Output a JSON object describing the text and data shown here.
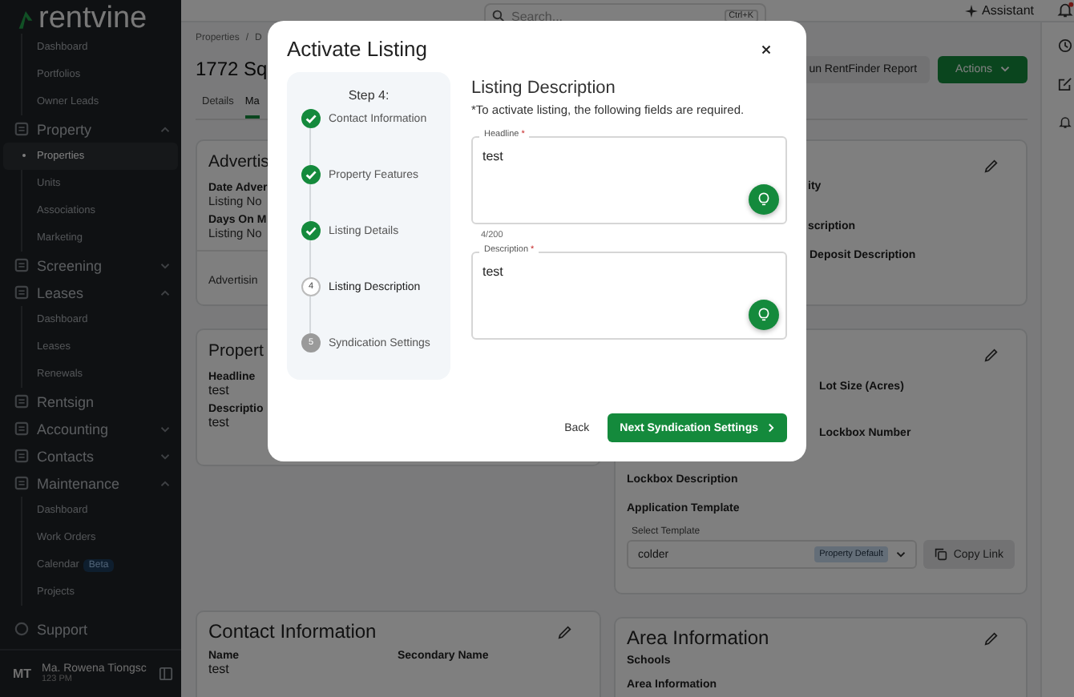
{
  "sidebar": {
    "logo": "rentvine",
    "top_links": [
      {
        "label": "Dashboard",
        "selected": false
      },
      {
        "label": "Portfolios",
        "selected": false
      },
      {
        "label": "Owner Leads",
        "selected": false
      }
    ],
    "groups": [
      {
        "label": "Property",
        "kind": "section",
        "expanded": true,
        "children": [
          {
            "label": "Properties",
            "selected": true
          },
          {
            "label": "Units",
            "selected": false
          },
          {
            "label": "Associations",
            "selected": false
          },
          {
            "label": "Marketing",
            "selected": false
          }
        ]
      },
      {
        "label": "Screening",
        "kind": "section",
        "expanded": false
      },
      {
        "label": "Leases",
        "kind": "section",
        "expanded": true,
        "children": [
          {
            "label": "Dashboard",
            "selected": false
          },
          {
            "label": "Leases",
            "selected": false
          },
          {
            "label": "Renewals",
            "selected": false
          }
        ]
      },
      {
        "label": "Rentsign",
        "kind": "link"
      },
      {
        "label": "Accounting",
        "kind": "section",
        "expanded": false
      },
      {
        "label": "Contacts",
        "kind": "section",
        "expanded": false
      },
      {
        "label": "Maintenance",
        "kind": "section",
        "expanded": true,
        "children": [
          {
            "label": "Dashboard",
            "selected": false
          },
          {
            "label": "Work Orders",
            "selected": false
          },
          {
            "label": "Calendar",
            "selected": false,
            "badge": "Beta"
          },
          {
            "label": "Projects",
            "selected": false
          }
        ]
      }
    ],
    "support": "Support",
    "user": {
      "initials": "MT",
      "name": "Ma. Rowena Tiongsc",
      "time": "123 PM"
    }
  },
  "topbar": {
    "search_placeholder": "Search...",
    "shortcut": "Ctrl+K",
    "assistant": "Assistant",
    "notifications_unread": true
  },
  "page": {
    "breadcrumb": [
      "Properties",
      "D"
    ],
    "breadcrumb_separator": "/",
    "title": "1772 Sq",
    "tabs": [
      {
        "label": "Details",
        "selected": false
      },
      {
        "label": "Ma",
        "selected": true
      }
    ],
    "actions": [
      {
        "label": "un RentFinder Report",
        "kind": "secondary"
      },
      {
        "label": "Actions",
        "kind": "primary"
      }
    ],
    "advertising_card": {
      "title": "Advertis",
      "fields": [
        {
          "label": "Date Adver",
          "value": "Listing No"
        },
        {
          "label": "Days On M",
          "value": "Listing No"
        }
      ],
      "footer": "Advertisin"
    },
    "property_card": {
      "title": "Propert",
      "fields": [
        {
          "label": "Headline",
          "value": "test"
        },
        {
          "label": "Descriptio",
          "value": "test"
        }
      ]
    },
    "contact_card": {
      "title": "Contact Information",
      "fields": [
        {
          "label": "Name",
          "value": "test"
        },
        {
          "label": "Secondary Name"
        }
      ]
    },
    "right_card_1": {
      "fields": [
        {
          "label": "ity"
        },
        {
          "label": "scription"
        },
        {
          "label": "Deposit Description"
        }
      ]
    },
    "right_card_2": {
      "side_fields": [
        {
          "label": "Lot Size (Acres)"
        },
        {
          "label": "Lockbox Number"
        }
      ],
      "fields": [
        {
          "label": "Lockbox Description"
        },
        {
          "label": "Application Template"
        }
      ],
      "template": {
        "label": "Select Template",
        "value": "colder",
        "badge": "Property Default"
      },
      "copy_button": "Copy Link"
    },
    "area_card": {
      "title": "Area Information",
      "fields": [
        {
          "label": "Schools"
        },
        {
          "label": "Area Information"
        }
      ]
    }
  },
  "modal": {
    "title": "Activate Listing",
    "step_heading": "Step 4:",
    "steps": [
      {
        "label": "Contact Information",
        "completed": true,
        "current": false
      },
      {
        "label": "Property Features",
        "completed": true,
        "current": false
      },
      {
        "label": "Listing Details",
        "completed": true,
        "current": false
      },
      {
        "label": "Listing Description",
        "completed": false,
        "current": true,
        "number": "4"
      },
      {
        "label": "Syndication Settings",
        "completed": false,
        "current": false,
        "number": "5"
      }
    ],
    "section_title": "Listing Description",
    "note": "*To activate listing, the following fields are required.",
    "fields": [
      {
        "label": "Headline",
        "required_mark": "*",
        "value": "test",
        "counter": "4/200"
      },
      {
        "label": "Description",
        "required_mark": "*",
        "value": "test"
      }
    ],
    "back": "Back",
    "next": "Next Syndication Settings"
  }
}
